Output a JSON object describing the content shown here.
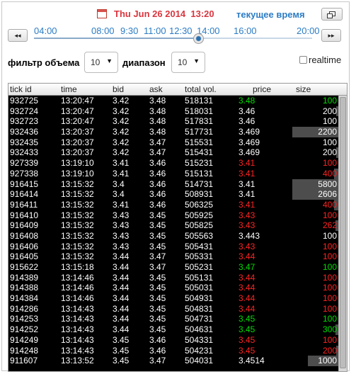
{
  "header": {
    "date_label": "Thu Jun 26 2014  13:20",
    "now_label": "текущее время"
  },
  "timeline": {
    "prev_label": "◂◂",
    "next_label": "▸▸",
    "ticks": [
      "04:00",
      "08:00",
      "9:30",
      "11:00",
      "12:30",
      "14:00",
      "16:00",
      "20:00"
    ],
    "position_fraction": 0.59
  },
  "filters": {
    "volume_label": "фильтр объема",
    "volume_value": "10",
    "range_label": "диапазон",
    "range_value": "10",
    "realtime_label": "realtime",
    "realtime_checked": false
  },
  "table": {
    "columns": [
      "tick id",
      "time",
      "bid",
      "ask",
      "total vol.",
      "price",
      "size"
    ],
    "colors": {
      "up": "#00dd00",
      "down": "#ff2222",
      "neutral": "#ffffff",
      "size_bar": "#4d4d4d"
    },
    "rows": [
      {
        "id": "932725",
        "time": "13:20:47",
        "bid": "3.42",
        "ask": "3.48",
        "vol": "518131",
        "price": "3.48",
        "pc": "up",
        "size": "100",
        "sc": "up",
        "bar": 0.0
      },
      {
        "id": "932724",
        "time": "13:20:47",
        "bid": "3.42",
        "ask": "3.48",
        "vol": "518031",
        "price": "3.46",
        "pc": "neutral",
        "size": "200",
        "sc": "neutral",
        "bar": 0.04
      },
      {
        "id": "932723",
        "time": "13:20:47",
        "bid": "3.42",
        "ask": "3.48",
        "vol": "517831",
        "price": "3.46",
        "pc": "neutral",
        "size": "100",
        "sc": "neutral",
        "bar": 0.0
      },
      {
        "id": "932436",
        "time": "13:20:37",
        "bid": "3.42",
        "ask": "3.48",
        "vol": "517731",
        "price": "3.469",
        "pc": "neutral",
        "size": "2200",
        "sc": "neutral",
        "bar": 0.88
      },
      {
        "id": "932435",
        "time": "13:20:37",
        "bid": "3.42",
        "ask": "3.47",
        "vol": "515531",
        "price": "3.469",
        "pc": "neutral",
        "size": "100",
        "sc": "neutral",
        "bar": 0.0
      },
      {
        "id": "932433",
        "time": "13:20:37",
        "bid": "3.42",
        "ask": "3.47",
        "vol": "515431",
        "price": "3.469",
        "pc": "neutral",
        "size": "200",
        "sc": "neutral",
        "bar": 0.04
      },
      {
        "id": "927339",
        "time": "13:19:10",
        "bid": "3.41",
        "ask": "3.46",
        "vol": "515231",
        "price": "3.41",
        "pc": "down",
        "size": "100",
        "sc": "down",
        "bar": 0.0
      },
      {
        "id": "927338",
        "time": "13:19:10",
        "bid": "3.41",
        "ask": "3.46",
        "vol": "515131",
        "price": "3.41",
        "pc": "down",
        "size": "400",
        "sc": "down",
        "bar": 0.08
      },
      {
        "id": "916415",
        "time": "13:15:32",
        "bid": "3.4",
        "ask": "3.46",
        "vol": "514731",
        "price": "3.41",
        "pc": "neutral",
        "size": "5800",
        "sc": "neutral",
        "bar": 0.88
      },
      {
        "id": "916414",
        "time": "13:15:32",
        "bid": "3.4",
        "ask": "3.46",
        "vol": "508931",
        "price": "3.41",
        "pc": "neutral",
        "size": "2606",
        "sc": "neutral",
        "bar": 0.88
      },
      {
        "id": "916411",
        "time": "13:15:32",
        "bid": "3.41",
        "ask": "3.46",
        "vol": "506325",
        "price": "3.41",
        "pc": "down",
        "size": "400",
        "sc": "down",
        "bar": 0.08
      },
      {
        "id": "916410",
        "time": "13:15:32",
        "bid": "3.43",
        "ask": "3.45",
        "vol": "505925",
        "price": "3.43",
        "pc": "down",
        "size": "100",
        "sc": "down",
        "bar": 0.0
      },
      {
        "id": "916409",
        "time": "13:15:32",
        "bid": "3.43",
        "ask": "3.45",
        "vol": "505825",
        "price": "3.43",
        "pc": "down",
        "size": "262",
        "sc": "down",
        "bar": 0.06
      },
      {
        "id": "916408",
        "time": "13:15:32",
        "bid": "3.43",
        "ask": "3.45",
        "vol": "505563",
        "price": "3.443",
        "pc": "neutral",
        "size": "100",
        "sc": "neutral",
        "bar": 0.0
      },
      {
        "id": "916406",
        "time": "13:15:32",
        "bid": "3.43",
        "ask": "3.45",
        "vol": "505431",
        "price": "3.43",
        "pc": "down",
        "size": "100",
        "sc": "down",
        "bar": 0.0
      },
      {
        "id": "916405",
        "time": "13:15:32",
        "bid": "3.44",
        "ask": "3.47",
        "vol": "505331",
        "price": "3.44",
        "pc": "down",
        "size": "100",
        "sc": "down",
        "bar": 0.0
      },
      {
        "id": "915622",
        "time": "13:15:18",
        "bid": "3.44",
        "ask": "3.47",
        "vol": "505231",
        "price": "3.47",
        "pc": "up",
        "size": "100",
        "sc": "up",
        "bar": 0.0
      },
      {
        "id": "914389",
        "time": "13:14:46",
        "bid": "3.44",
        "ask": "3.45",
        "vol": "505131",
        "price": "3.44",
        "pc": "down",
        "size": "100",
        "sc": "down",
        "bar": 0.0
      },
      {
        "id": "914388",
        "time": "13:14:46",
        "bid": "3.44",
        "ask": "3.45",
        "vol": "505031",
        "price": "3.44",
        "pc": "down",
        "size": "100",
        "sc": "down",
        "bar": 0.0
      },
      {
        "id": "914384",
        "time": "13:14:46",
        "bid": "3.44",
        "ask": "3.45",
        "vol": "504931",
        "price": "3.44",
        "pc": "down",
        "size": "100",
        "sc": "down",
        "bar": 0.0
      },
      {
        "id": "914286",
        "time": "13:14:43",
        "bid": "3.44",
        "ask": "3.45",
        "vol": "504831",
        "price": "3.44",
        "pc": "down",
        "size": "100",
        "sc": "down",
        "bar": 0.0
      },
      {
        "id": "914253",
        "time": "13:14:43",
        "bid": "3.44",
        "ask": "3.45",
        "vol": "504731",
        "price": "3.45",
        "pc": "up",
        "size": "100",
        "sc": "up",
        "bar": 0.0
      },
      {
        "id": "914252",
        "time": "13:14:43",
        "bid": "3.44",
        "ask": "3.45",
        "vol": "504631",
        "price": "3.45",
        "pc": "up",
        "size": "300",
        "sc": "up",
        "bar": 0.06
      },
      {
        "id": "914249",
        "time": "13:14:43",
        "bid": "3.45",
        "ask": "3.46",
        "vol": "504331",
        "price": "3.45",
        "pc": "down",
        "size": "100",
        "sc": "down",
        "bar": 0.0
      },
      {
        "id": "914248",
        "time": "13:14:43",
        "bid": "3.45",
        "ask": "3.46",
        "vol": "504231",
        "price": "3.45",
        "pc": "down",
        "size": "200",
        "sc": "down",
        "bar": 0.04
      },
      {
        "id": "911607",
        "time": "13:13:52",
        "bid": "3.45",
        "ask": "3.47",
        "vol": "504031",
        "price": "3.4514",
        "pc": "neutral",
        "size": "1000",
        "sc": "neutral",
        "bar": 0.58
      }
    ]
  }
}
